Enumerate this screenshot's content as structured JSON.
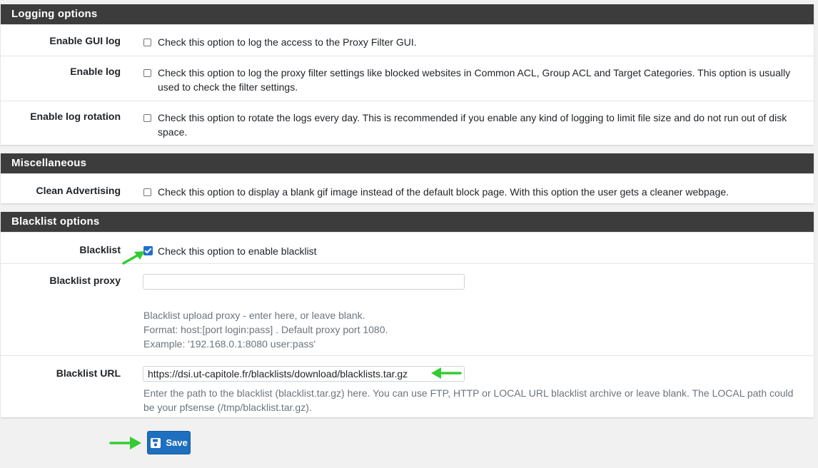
{
  "logging": {
    "heading": "Logging options",
    "rows": [
      {
        "label": "Enable GUI log",
        "desc": "Check this option to log the access to the Proxy Filter GUI.",
        "checked": false
      },
      {
        "label": "Enable log",
        "desc": "Check this option to log the proxy filter settings like blocked websites in Common ACL, Group ACL and Target Categories. This option is usually used to check the filter settings.",
        "checked": false
      },
      {
        "label": "Enable log rotation",
        "desc": "Check this option to rotate the logs every day. This is recommended if you enable any kind of logging to limit file size and do not run out of disk space.",
        "checked": false
      }
    ]
  },
  "misc": {
    "heading": "Miscellaneous",
    "rows": [
      {
        "label": "Clean Advertising",
        "desc": "Check this option to display a blank gif image instead of the default block page. With this option the user gets a cleaner webpage.",
        "checked": false
      }
    ]
  },
  "blacklist": {
    "heading": "Blacklist options",
    "enable": {
      "label": "Blacklist",
      "desc": "Check this option to enable blacklist",
      "checked": true
    },
    "proxy": {
      "label": "Blacklist proxy",
      "value": "",
      "help1": "Blacklist upload proxy - enter here, or leave blank.",
      "help2": "Format: host:[port login:pass] . Default proxy port 1080.",
      "help3": "Example: '192.168.0.1:8080 user:pass'"
    },
    "url": {
      "label": "Blacklist URL",
      "value": "https://dsi.ut-capitole.fr/blacklists/download/blacklists.tar.gz",
      "help": "Enter the path to the blacklist (blacklist.tar.gz) here. You can use FTP, HTTP or LOCAL URL blacklist archive or leave blank. The LOCAL path could be your pfsense (/tmp/blacklist.tar.gz)."
    }
  },
  "save_label": "Save",
  "colors": {
    "heading_bg": "#3c3c3c",
    "button": "#1e6fbf",
    "arrow": "#33cc33"
  },
  "icons": {
    "save": "save-icon",
    "arrow": "green-arrow-icon"
  }
}
